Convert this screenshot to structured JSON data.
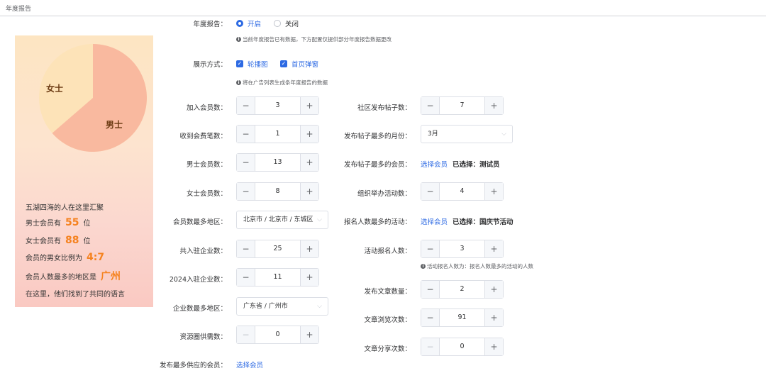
{
  "page": {
    "title": "年度报告"
  },
  "preview": {
    "pie": {
      "female_label": "女士",
      "male_label": "男士",
      "female": 4,
      "male": 7,
      "female_color": "#fde3b8",
      "male_color": "#f9b99f"
    },
    "line1": "五湖四海的人在这里汇聚",
    "line2_prefix": "男士会员有",
    "line2_value": "55",
    "line2_suffix": "位",
    "line3_prefix": "女士会员有",
    "line3_value": "88",
    "line3_suffix": "位",
    "line4_prefix": "会员的男女比例为",
    "line4_value": "4:7",
    "line5_prefix": "会员人数最多的地区是",
    "line5_value": "广州",
    "line6": "在这里，他们找到了共同的语言"
  },
  "form": {
    "report": {
      "label": "年度报告：",
      "on": "开启",
      "off": "关闭",
      "hint": "当前年度报告已有数据，下方配置仅提供部分年度报告数据更改"
    },
    "display": {
      "label": "展示方式：",
      "opt1": "轮播图",
      "opt2": "首页弹窗",
      "hint": "将在广告列表生成条年度报告的数据"
    },
    "left": {
      "join_members": {
        "label": "加入会员数：",
        "value": "3"
      },
      "fees": {
        "label": "收到会费笔数：",
        "value": "1"
      },
      "male": {
        "label": "男士会员数：",
        "value": "13"
      },
      "female": {
        "label": "女士会员数：",
        "value": "8"
      },
      "region": {
        "label": "会员数最多地区：",
        "value": "北京市 / 北京市 / 东城区"
      },
      "companies": {
        "label": "共入驻企业数：",
        "value": "25"
      },
      "companies_2024": {
        "label": "2024入驻企业数：",
        "value": "11"
      },
      "company_region": {
        "label": "企业数最多地区：",
        "value": "广东省 / 广州市"
      },
      "resources": {
        "label": "资源圈供需数：",
        "value": "0"
      },
      "supply_member": {
        "label": "发布最多供应的会员：",
        "link": "选择会员"
      }
    },
    "right": {
      "posts": {
        "label": "社区发布帖子数：",
        "value": "7"
      },
      "post_month": {
        "label": "发布帖子最多的月份：",
        "value": "3月"
      },
      "post_member": {
        "label": "发布帖子最多的会员：",
        "link": "选择会员",
        "selected": "已选择：测试员"
      },
      "activities": {
        "label": "组织举办活动数：",
        "value": "4"
      },
      "top_activity": {
        "label": "报名人数最多的活动：",
        "link": "选择会员",
        "selected": "已选择：国庆节活动"
      },
      "signups": {
        "label": "活动报名人数：",
        "value": "3",
        "hint": "活动报名人数为：报名人数最多的活动的人数"
      },
      "articles": {
        "label": "发布文章数量：",
        "value": "2"
      },
      "article_views": {
        "label": "文章浏览次数：",
        "value": "91"
      },
      "article_shares": {
        "label": "文章分享次数：",
        "value": "0"
      }
    }
  }
}
